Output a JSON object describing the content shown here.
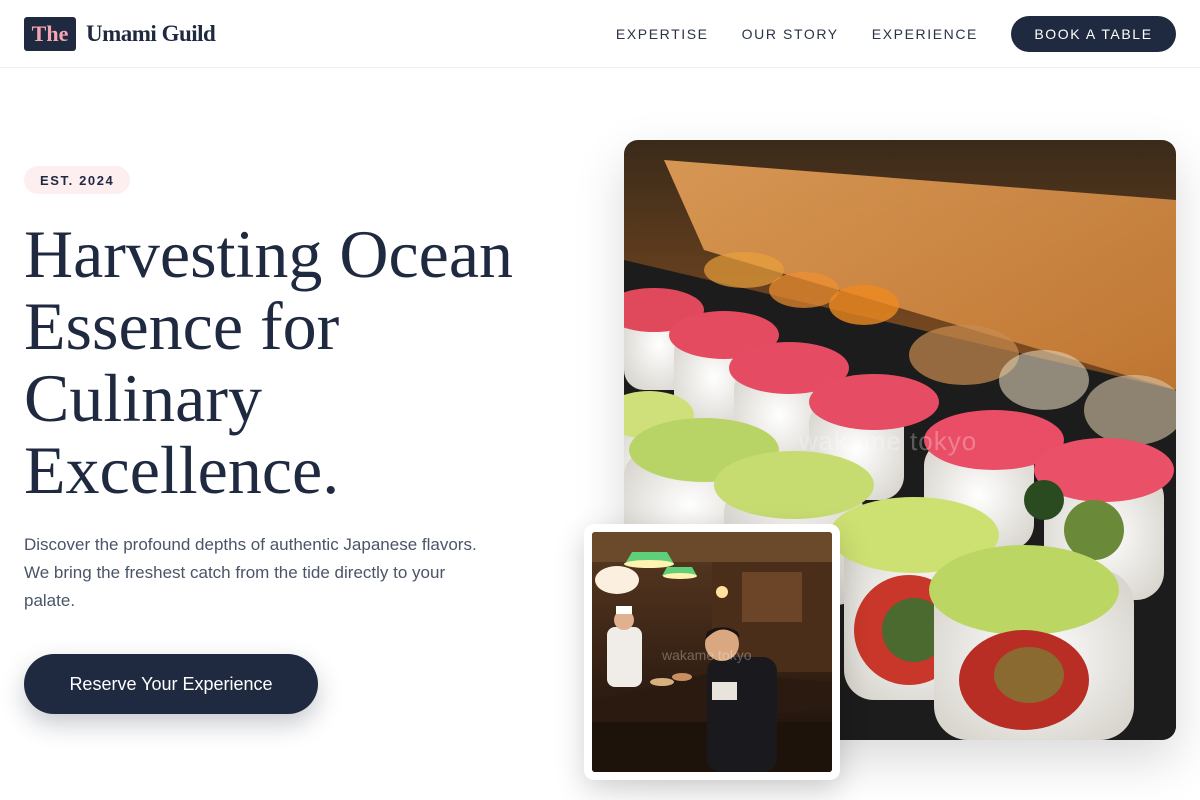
{
  "header": {
    "logo_mark": "The",
    "logo_name": "Umami Guild",
    "nav": [
      "EXPERTISE",
      "OUR STORY",
      "EXPERIENCE"
    ],
    "book_label": "BOOK A TABLE"
  },
  "hero": {
    "badge": "EST. 2024",
    "headline": "Harvesting Ocean Essence for Culinary Excellence.",
    "description": "Discover the profound depths of authentic Japanese flavors. We bring the freshest catch from the tide directly to your palate.",
    "cta_label": "Reserve Your Experience"
  },
  "images": {
    "main_watermark": "wakame tokyo",
    "inset_watermark": "wakame tokyo"
  },
  "colors": {
    "primary": "#1f2a40",
    "accent_pink": "#f4a6b4",
    "badge_bg": "#fdeef0"
  }
}
